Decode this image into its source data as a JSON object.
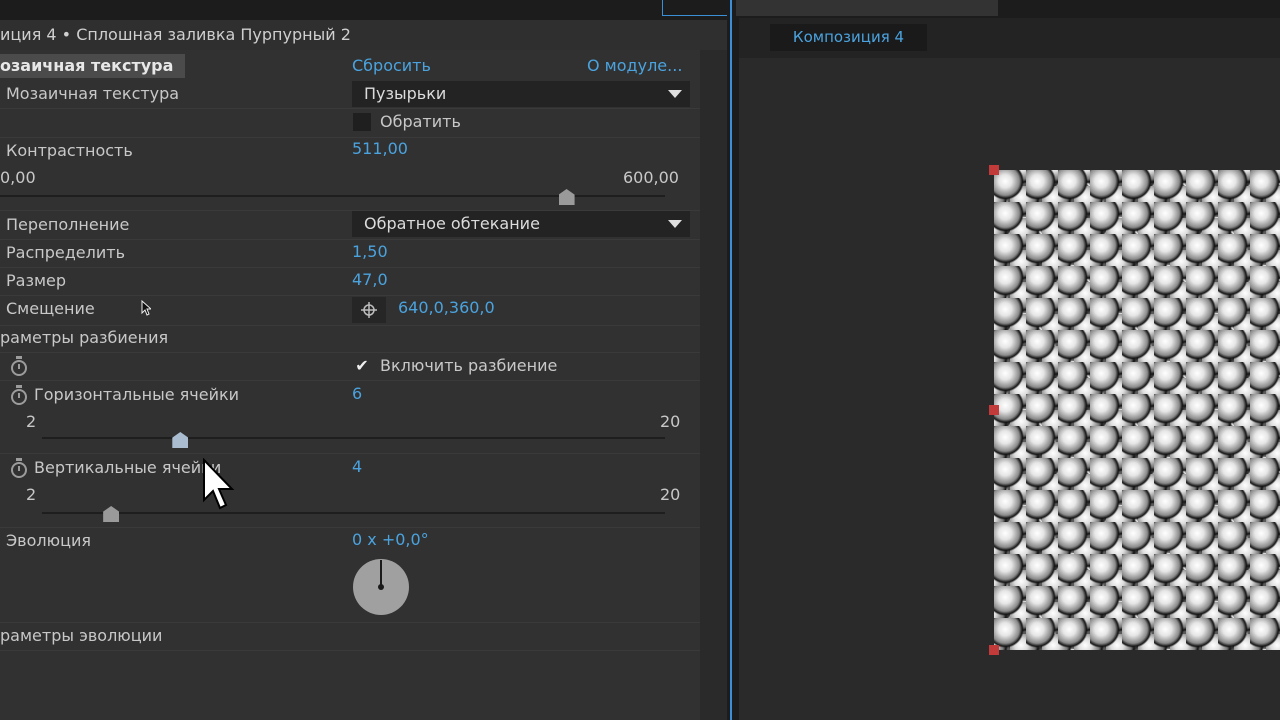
{
  "panel": {
    "header_title": "иция 4 • Сплошная заливка Пурпурный 2",
    "effect": {
      "name": "озаичная текстура",
      "reset": "Сбросить",
      "about": "О модуле..."
    },
    "rows": {
      "texture": {
        "label": "Мозаичная текстура",
        "value": "Пузырьки"
      },
      "invert": {
        "label": "Обратить",
        "checked": false
      },
      "contrast": {
        "label": "Контрастность",
        "value": "511,00",
        "min": "0,00",
        "max": "600,00",
        "level": 0.852
      },
      "overflow": {
        "label": "Переполнение",
        "value": "Обратное обтекание"
      },
      "spread": {
        "label": "Распределить",
        "value": "1,50"
      },
      "size": {
        "label": "Размер",
        "value": "47,0"
      },
      "offset": {
        "label": "Смещение",
        "value": "640,0,360,0"
      },
      "tiling_group": {
        "label": "раметры разбиения"
      },
      "enable_tiling": {
        "label": "Включить разбиение",
        "checked": true
      },
      "h_cells": {
        "label": "Горизонтальные ячейки",
        "value": "6",
        "min": "2",
        "max": "20",
        "level": 0.222
      },
      "v_cells": {
        "label": "Вертикальные ячейки",
        "value": "4",
        "min": "2",
        "max": "20",
        "level": 0.111
      },
      "evolution": {
        "label": "Эволюция",
        "value": "0 x +0,0°"
      },
      "evolution_group": {
        "label": "раметры эволюции"
      }
    }
  },
  "viewer": {
    "tab_label": "Композиция 4"
  },
  "colors": {
    "accent_blue": "#4aa3df",
    "handle_red": "#c23a3a"
  },
  "icons": [
    "dropdown-caret-icon",
    "stopwatch-icon",
    "crosshair-icon",
    "checkmark-icon",
    "arrow-cursor-icon",
    "angle-dial-icon"
  ]
}
